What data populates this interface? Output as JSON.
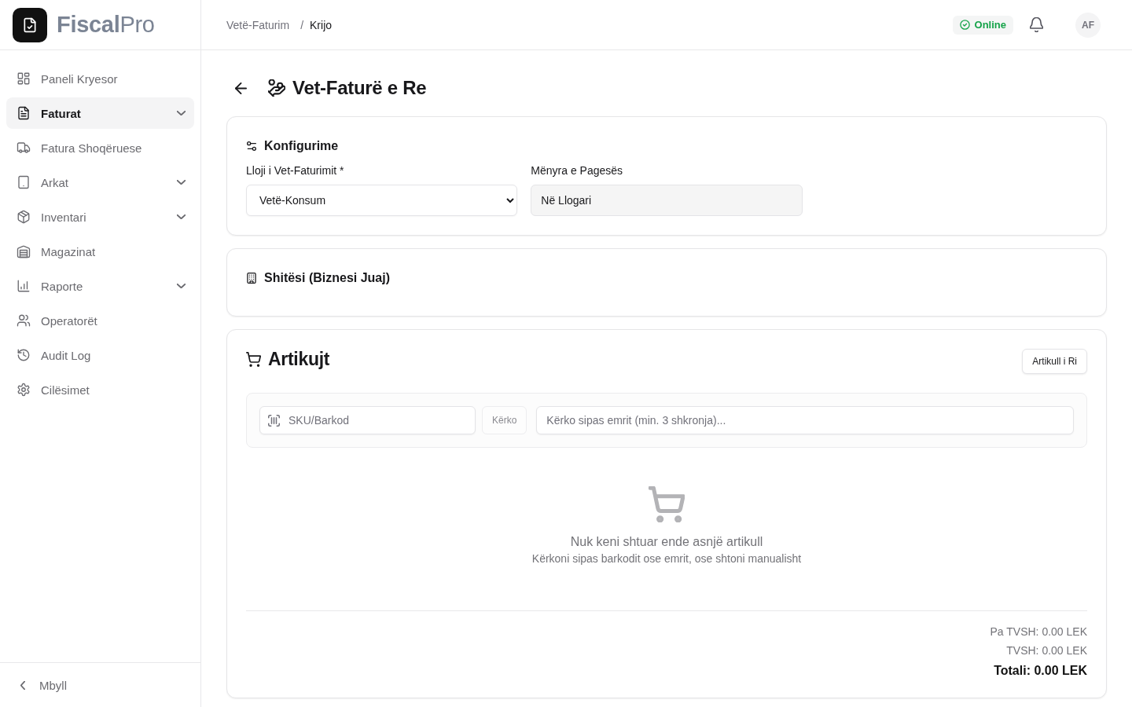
{
  "sidebar": {
    "brand": "**Fiscal**Pro",
    "items": [
      {
        "label": "Paneli Kryesor",
        "selected": false,
        "has_submenu": false
      },
      {
        "label": "Faturat",
        "selected": true,
        "has_submenu": true
      },
      {
        "label": "Fatura Shoqëruese",
        "selected": false,
        "has_submenu": false
      },
      {
        "label": "Arkat",
        "selected": false,
        "has_submenu": true
      },
      {
        "label": "Inventari",
        "selected": false,
        "has_submenu": true
      },
      {
        "label": "Magazinat",
        "selected": false,
        "has_submenu": false
      },
      {
        "label": "Raporte",
        "selected": false,
        "has_submenu": true
      },
      {
        "label": "Operatorët",
        "selected": false,
        "has_submenu": false
      },
      {
        "label": "Audit Log",
        "selected": false,
        "has_submenu": false
      },
      {
        "label": "Cilësimet",
        "selected": false,
        "has_submenu": false
      }
    ],
    "collapse_label": "Mbyll"
  },
  "header": {
    "breadcrumb": [
      {
        "label": "Vetë-Faturim",
        "current": false
      },
      {
        "label": "Krijo",
        "current": true
      }
    ],
    "breadcrumb_separator": "/",
    "status": {
      "label": "Online",
      "online": true
    },
    "avatar_initials": "AF"
  },
  "page": {
    "title": "Vet-Faturë e Re"
  },
  "configuration": {
    "title": "Konfigurime",
    "fields": [
      {
        "label": "Lloji i Vet-Faturimit *",
        "kind": "select",
        "value": "Vetë-Konsum"
      },
      {
        "label": "Mënyra e Pagesës",
        "kind": "readonly",
        "value": "Në Llogari"
      }
    ]
  },
  "seller": {
    "title": "Shitësi (Biznesi Juaj)"
  },
  "items": {
    "title": "Artikujt",
    "add_button": "Artikull i Ri",
    "sku_field": {
      "placeholder": "SKU/Barkod"
    },
    "search_button": {
      "label": "Kërko",
      "disabled": true
    },
    "name_field": {
      "placeholder": "Kërko sipas emrit (min. 3 shkronja)..."
    },
    "empty_state": {
      "title": "Nuk keni shtuar ende asnjë artikull",
      "subtitle": "Kërkoni sipas barkodit ose emrit, ose shtoni manualisht"
    },
    "totals": [
      {
        "kind": "subtotal",
        "text": "Pa TVSH: 0.00 LEK"
      },
      {
        "kind": "vat",
        "text": "TVSH: 0.00 LEK"
      },
      {
        "kind": "total",
        "text": "Totali: 0.00 LEK"
      }
    ]
  }
}
